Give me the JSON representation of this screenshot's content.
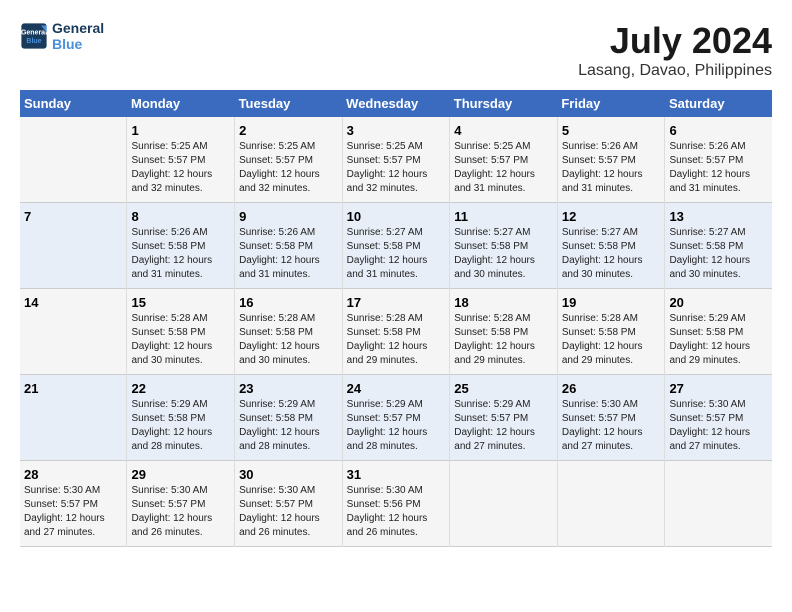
{
  "logo": {
    "part1": "General",
    "part2": "Blue"
  },
  "title": "July 2024",
  "subtitle": "Lasang, Davao, Philippines",
  "headers": [
    "Sunday",
    "Monday",
    "Tuesday",
    "Wednesday",
    "Thursday",
    "Friday",
    "Saturday"
  ],
  "weeks": [
    [
      {
        "day": "",
        "info": ""
      },
      {
        "day": "1",
        "info": "Sunrise: 5:25 AM\nSunset: 5:57 PM\nDaylight: 12 hours\nand 32 minutes."
      },
      {
        "day": "2",
        "info": "Sunrise: 5:25 AM\nSunset: 5:57 PM\nDaylight: 12 hours\nand 32 minutes."
      },
      {
        "day": "3",
        "info": "Sunrise: 5:25 AM\nSunset: 5:57 PM\nDaylight: 12 hours\nand 32 minutes."
      },
      {
        "day": "4",
        "info": "Sunrise: 5:25 AM\nSunset: 5:57 PM\nDaylight: 12 hours\nand 31 minutes."
      },
      {
        "day": "5",
        "info": "Sunrise: 5:26 AM\nSunset: 5:57 PM\nDaylight: 12 hours\nand 31 minutes."
      },
      {
        "day": "6",
        "info": "Sunrise: 5:26 AM\nSunset: 5:57 PM\nDaylight: 12 hours\nand 31 minutes."
      }
    ],
    [
      {
        "day": "7",
        "info": ""
      },
      {
        "day": "8",
        "info": "Sunrise: 5:26 AM\nSunset: 5:58 PM\nDaylight: 12 hours\nand 31 minutes."
      },
      {
        "day": "9",
        "info": "Sunrise: 5:26 AM\nSunset: 5:58 PM\nDaylight: 12 hours\nand 31 minutes."
      },
      {
        "day": "10",
        "info": "Sunrise: 5:27 AM\nSunset: 5:58 PM\nDaylight: 12 hours\nand 31 minutes."
      },
      {
        "day": "11",
        "info": "Sunrise: 5:27 AM\nSunset: 5:58 PM\nDaylight: 12 hours\nand 30 minutes."
      },
      {
        "day": "12",
        "info": "Sunrise: 5:27 AM\nSunset: 5:58 PM\nDaylight: 12 hours\nand 30 minutes."
      },
      {
        "day": "13",
        "info": "Sunrise: 5:27 AM\nSunset: 5:58 PM\nDaylight: 12 hours\nand 30 minutes."
      }
    ],
    [
      {
        "day": "14",
        "info": ""
      },
      {
        "day": "15",
        "info": "Sunrise: 5:28 AM\nSunset: 5:58 PM\nDaylight: 12 hours\nand 30 minutes."
      },
      {
        "day": "16",
        "info": "Sunrise: 5:28 AM\nSunset: 5:58 PM\nDaylight: 12 hours\nand 30 minutes."
      },
      {
        "day": "17",
        "info": "Sunrise: 5:28 AM\nSunset: 5:58 PM\nDaylight: 12 hours\nand 29 minutes."
      },
      {
        "day": "18",
        "info": "Sunrise: 5:28 AM\nSunset: 5:58 PM\nDaylight: 12 hours\nand 29 minutes."
      },
      {
        "day": "19",
        "info": "Sunrise: 5:28 AM\nSunset: 5:58 PM\nDaylight: 12 hours\nand 29 minutes."
      },
      {
        "day": "20",
        "info": "Sunrise: 5:29 AM\nSunset: 5:58 PM\nDaylight: 12 hours\nand 29 minutes."
      }
    ],
    [
      {
        "day": "21",
        "info": ""
      },
      {
        "day": "22",
        "info": "Sunrise: 5:29 AM\nSunset: 5:58 PM\nDaylight: 12 hours\nand 28 minutes."
      },
      {
        "day": "23",
        "info": "Sunrise: 5:29 AM\nSunset: 5:58 PM\nDaylight: 12 hours\nand 28 minutes."
      },
      {
        "day": "24",
        "info": "Sunrise: 5:29 AM\nSunset: 5:57 PM\nDaylight: 12 hours\nand 28 minutes."
      },
      {
        "day": "25",
        "info": "Sunrise: 5:29 AM\nSunset: 5:57 PM\nDaylight: 12 hours\nand 27 minutes."
      },
      {
        "day": "26",
        "info": "Sunrise: 5:30 AM\nSunset: 5:57 PM\nDaylight: 12 hours\nand 27 minutes."
      },
      {
        "day": "27",
        "info": "Sunrise: 5:30 AM\nSunset: 5:57 PM\nDaylight: 12 hours\nand 27 minutes."
      }
    ],
    [
      {
        "day": "28",
        "info": "Sunrise: 5:30 AM\nSunset: 5:57 PM\nDaylight: 12 hours\nand 27 minutes."
      },
      {
        "day": "29",
        "info": "Sunrise: 5:30 AM\nSunset: 5:57 PM\nDaylight: 12 hours\nand 26 minutes."
      },
      {
        "day": "30",
        "info": "Sunrise: 5:30 AM\nSunset: 5:57 PM\nDaylight: 12 hours\nand 26 minutes."
      },
      {
        "day": "31",
        "info": "Sunrise: 5:30 AM\nSunset: 5:56 PM\nDaylight: 12 hours\nand 26 minutes."
      },
      {
        "day": "",
        "info": ""
      },
      {
        "day": "",
        "info": ""
      },
      {
        "day": "",
        "info": ""
      }
    ]
  ]
}
